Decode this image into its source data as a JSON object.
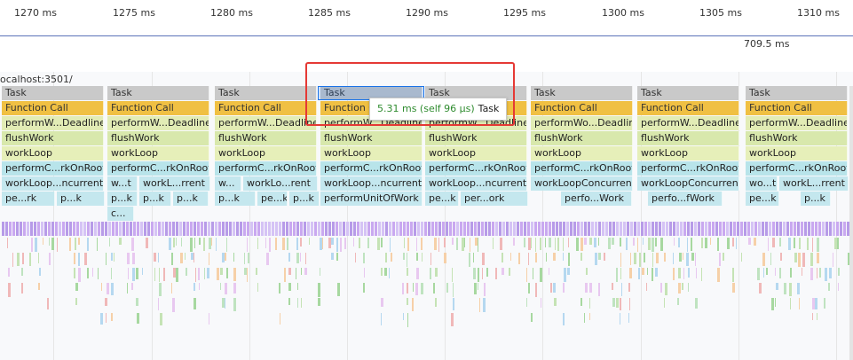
{
  "ruler": {
    "ticks": [
      "1270 ms",
      "1275 ms",
      "1280 ms",
      "1285 ms",
      "1290 ms",
      "1295 ms",
      "1300 ms",
      "1305 ms",
      "1310 ms"
    ]
  },
  "marker_time": "709.5 ms",
  "url_label": "ocalhost:3501/",
  "tooltip": {
    "duration": "5.31 ms (self 96 µs)",
    "name": "Task"
  },
  "flame": {
    "columns": [
      {
        "rows": [
          [
            {
              "t": "Task"
            }
          ],
          [
            {
              "t": "Function Call"
            }
          ],
          [
            {
              "t": "performW...Deadline"
            }
          ],
          [
            {
              "t": "flushWork"
            }
          ],
          [
            {
              "t": "workLoop"
            }
          ],
          [
            {
              "t": "performC...rkOnRoot"
            }
          ],
          [
            {
              "t": "workLoop...ncurrent"
            }
          ],
          [
            {
              "t": "pe...rk",
              "w": 60
            },
            {
              "t": "p...k",
              "w": 54
            }
          ]
        ]
      },
      {
        "rows": [
          [
            {
              "t": "Task"
            }
          ],
          [
            {
              "t": "Function Call"
            }
          ],
          [
            {
              "t": "performW...Deadline"
            }
          ],
          [
            {
              "t": "flushWork"
            }
          ],
          [
            {
              "t": "workLoop"
            }
          ],
          [
            {
              "t": "performC...rkOnRoot"
            }
          ],
          [
            {
              "t": "w...t",
              "w": 34
            },
            {
              "t": "workL...rrent",
              "w": 80
            }
          ],
          [
            {
              "t": "p...k",
              "w": 34
            },
            {
              "t": "p...k",
              "w": 36
            },
            {
              "t": "p...k",
              "w": 40
            }
          ],
          [
            {
              "t": "c...",
              "w": 30
            }
          ]
        ]
      },
      {
        "rows": [
          [
            {
              "t": "Task"
            }
          ],
          [
            {
              "t": "Function Call"
            }
          ],
          [
            {
              "t": "performW...Deadline"
            }
          ],
          [
            {
              "t": "flushWork"
            }
          ],
          [
            {
              "t": "workLoop"
            }
          ],
          [
            {
              "t": "performC...rkOnRoot"
            }
          ],
          [
            {
              "t": "w...",
              "w": 30
            },
            {
              "t": "workLo...rent",
              "w": 84
            }
          ],
          [
            {
              "t": "p...k",
              "w": 46
            },
            {
              "t": "pe...k",
              "w": 34
            },
            {
              "t": "p...k",
              "w": 34
            }
          ]
        ]
      },
      {
        "rows": [
          [
            {
              "t": "Task"
            }
          ],
          [
            {
              "t": "Function Call"
            }
          ],
          [
            {
              "t": "performW...Deadline"
            }
          ],
          [
            {
              "t": "flushWork"
            }
          ],
          [
            {
              "t": "workLoop"
            }
          ],
          [
            {
              "t": "performC...rkOnRoot"
            }
          ],
          [
            {
              "t": "workLoop...ncurrent"
            }
          ],
          [
            {
              "t": "performUnitOfWork"
            }
          ]
        ]
      },
      {
        "rows": [
          [
            {
              "t": "Task"
            }
          ],
          [
            {
              "t": "Function Call"
            }
          ],
          [
            {
              "t": "performW...Deadline"
            }
          ],
          [
            {
              "t": "flushWork"
            }
          ],
          [
            {
              "t": "workLoop"
            }
          ],
          [
            {
              "t": "performC...rkOnRoot"
            }
          ],
          [
            {
              "t": "workLoop...ncurrent"
            }
          ],
          [
            {
              "t": "pe...k",
              "w": 38
            },
            {
              "t": "per...ork",
              "w": 76
            }
          ]
        ]
      },
      {
        "rows": [
          [
            {
              "t": "Task"
            }
          ],
          [
            {
              "t": "Function Call"
            }
          ],
          [
            {
              "t": "performWo...Deadline"
            }
          ],
          [
            {
              "t": "flushWork"
            }
          ],
          [
            {
              "t": "workLoop"
            }
          ],
          [
            {
              "t": "performC...rkOnRoot"
            }
          ],
          [
            {
              "t": "workLoopConcurrent"
            }
          ],
          [
            {
              "t": "perfo...Work",
              "w": 80,
              "off": 34
            }
          ]
        ]
      },
      {
        "rows": [
          [
            {
              "t": "Task"
            }
          ],
          [
            {
              "t": "Function Call"
            }
          ],
          [
            {
              "t": "performW...Deadline"
            }
          ],
          [
            {
              "t": "flushWork"
            }
          ],
          [
            {
              "t": "workLoop"
            }
          ],
          [
            {
              "t": "performC...rkOnRoot"
            }
          ],
          [
            {
              "t": "workLoopConcurrent"
            }
          ],
          [
            {
              "t": "perfo...fWork",
              "w": 84,
              "off": 12
            }
          ]
        ]
      },
      {
        "rows": [
          [
            {
              "t": "Task"
            }
          ],
          [
            {
              "t": "Function Call"
            }
          ],
          [
            {
              "t": "performW...Deadline"
            }
          ],
          [
            {
              "t": "flushWork"
            }
          ],
          [
            {
              "t": "workLoop"
            }
          ],
          [
            {
              "t": "performC...rkOnRoot"
            }
          ],
          [
            {
              "t": "wo...t",
              "w": 36
            },
            {
              "t": "workL...rrent",
              "w": 78
            }
          ],
          [
            {
              "t": "pe...k",
              "w": 38
            },
            {
              "t": "p...k",
              "w": 34,
              "off": 22
            }
          ]
        ]
      }
    ]
  }
}
